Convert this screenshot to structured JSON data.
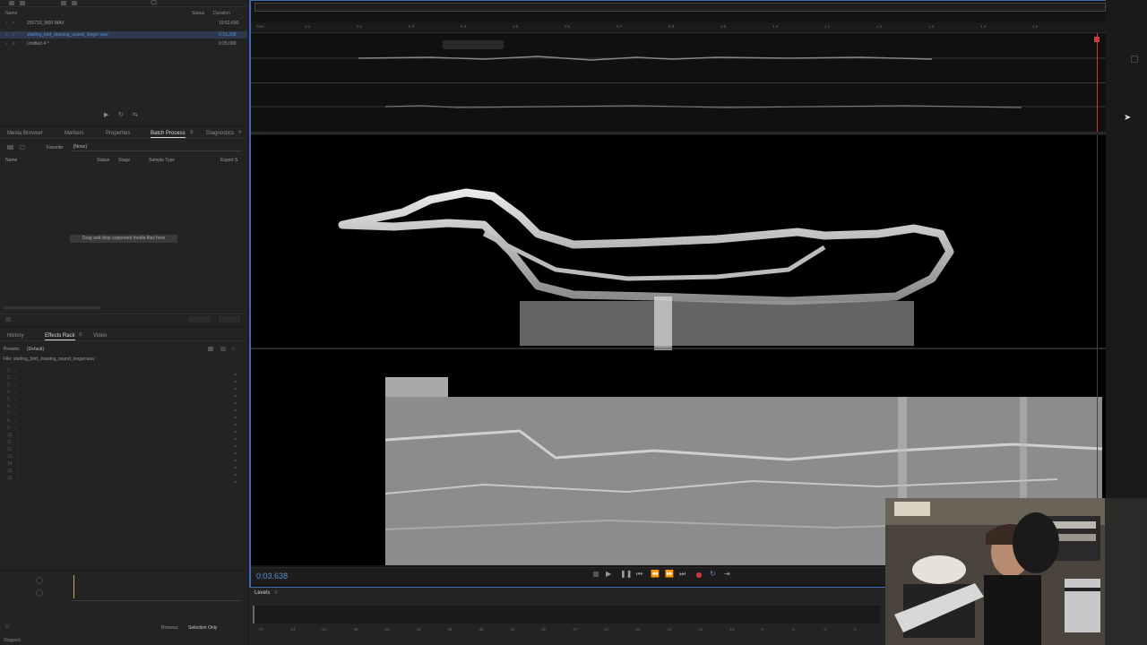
{
  "files": {
    "header": {
      "name": "Name",
      "status": "Status",
      "duration": "Duration"
    },
    "rows": [
      {
        "name": "250723_M00.WAV",
        "duration": "19:52.690",
        "selected": false
      },
      {
        "name": "starling_bird_drawing_sound_longer.wav",
        "duration": "0:15.208",
        "selected": true
      },
      {
        "name": "Untitled 4 *",
        "duration": "0:25.000",
        "selected": false
      }
    ]
  },
  "batch": {
    "tabs": [
      "Media Browser",
      "Markers",
      "Properties",
      "Batch Process",
      "Diagnostics"
    ],
    "favorite_label": "Favorite:",
    "favorite_value": "[None]",
    "columns": {
      "name": "Name",
      "status": "Status",
      "stage": "Stage",
      "sample_type": "Sample Type",
      "export": "Export S"
    },
    "drop_hint": "Drag and drop supported media files here"
  },
  "effects": {
    "tabs": [
      "History",
      "Effects Rack",
      "Video"
    ],
    "presets_label": "Presets:",
    "presets_value": "(Default)",
    "file_label": "File: starling_bird_drawing_sound_longer.wav",
    "slots": [
      "1",
      "2",
      "3",
      "4",
      "5",
      "6",
      "7",
      "8",
      "9",
      "10",
      "11",
      "12",
      "13",
      "14",
      "15",
      "16"
    ]
  },
  "bottom_left": {
    "process_label": "Process:",
    "process_value": "Selection Only",
    "status_text": "Stopped"
  },
  "editor": {
    "ruler_unit": "hms",
    "ruler_labels": [
      "0.1",
      "0.2",
      "0.3",
      "0.4",
      "0.5",
      "0.6",
      "0.7",
      "0.8",
      "0.9",
      "1.0",
      "1.1",
      "1.2",
      "1.3",
      "1.4",
      "1.5"
    ],
    "time_display": "0:03.638"
  },
  "levels": {
    "label": "Levels",
    "scale": [
      "-57",
      "-54",
      "-51",
      "-48",
      "-45",
      "-42",
      "-39",
      "-36",
      "-33",
      "-30",
      "-27",
      "-24",
      "-21",
      "-18",
      "-15",
      "-12",
      "-9",
      "-6",
      "-3",
      "0"
    ]
  },
  "colors": {
    "accent": "#5b8fd4",
    "record": "#d03a3a",
    "panel": "#232323",
    "background": "#1d1d1d"
  }
}
